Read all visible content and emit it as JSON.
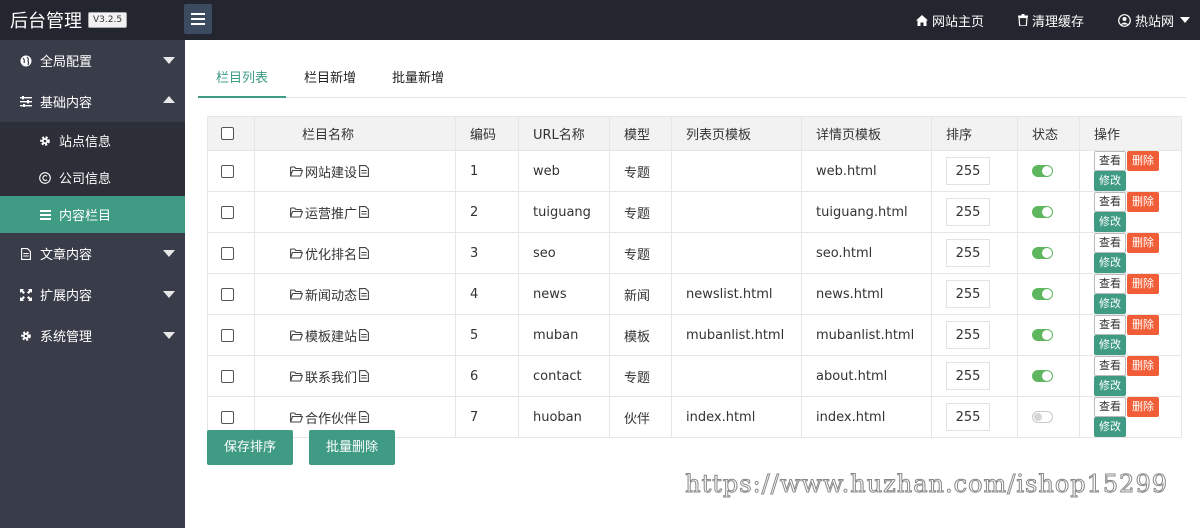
{
  "header": {
    "logo": "后台管理",
    "version": "V3.2.5",
    "links": [
      {
        "label": "网站主页",
        "icon": "home-icon"
      },
      {
        "label": "清理缓存",
        "icon": "trash-icon"
      },
      {
        "label": "热站网",
        "icon": "user-icon"
      }
    ]
  },
  "sidebar": {
    "items": [
      {
        "label": "全局配置",
        "icon": "globe-icon"
      },
      {
        "label": "基础内容",
        "icon": "sliders-icon"
      },
      {
        "label": "文章内容",
        "icon": "file-icon"
      },
      {
        "label": "扩展内容",
        "icon": "expand-icon"
      },
      {
        "label": "系统管理",
        "icon": "gear-icon"
      }
    ],
    "sub": [
      {
        "label": "站点信息",
        "icon": "gear-icon"
      },
      {
        "label": "公司信息",
        "icon": "copyright-icon"
      },
      {
        "label": "内容栏目",
        "icon": "list-icon"
      }
    ]
  },
  "tabs": [
    "栏目列表",
    "栏目新增",
    "批量新增"
  ],
  "table": {
    "headers": [
      "栏目名称",
      "编码",
      "URL名称",
      "模型",
      "列表页模板",
      "详情页模板",
      "排序",
      "状态",
      "操作"
    ],
    "rows": [
      {
        "name": "网站建设",
        "code": "1",
        "url": "web",
        "model": "专题",
        "list_tpl": "",
        "detail_tpl": "web.html",
        "sort": "255",
        "status": true
      },
      {
        "name": "运营推广",
        "code": "2",
        "url": "tuiguang",
        "model": "专题",
        "list_tpl": "",
        "detail_tpl": "tuiguang.html",
        "sort": "255",
        "status": true
      },
      {
        "name": "优化排名",
        "code": "3",
        "url": "seo",
        "model": "专题",
        "list_tpl": "",
        "detail_tpl": "seo.html",
        "sort": "255",
        "status": true
      },
      {
        "name": "新闻动态",
        "code": "4",
        "url": "news",
        "model": "新闻",
        "list_tpl": "newslist.html",
        "detail_tpl": "news.html",
        "sort": "255",
        "status": true
      },
      {
        "name": "模板建站",
        "code": "5",
        "url": "muban",
        "model": "模板",
        "list_tpl": "mubanlist.html",
        "detail_tpl": "mubanlist.html",
        "sort": "255",
        "status": true
      },
      {
        "name": "联系我们",
        "code": "6",
        "url": "contact",
        "model": "专题",
        "list_tpl": "",
        "detail_tpl": "about.html",
        "sort": "255",
        "status": true
      },
      {
        "name": "合作伙伴",
        "code": "7",
        "url": "huoban",
        "model": "伙伴",
        "list_tpl": "index.html",
        "detail_tpl": "index.html",
        "sort": "255",
        "status": false
      }
    ],
    "row_actions": {
      "view": "查看",
      "delete": "删除",
      "edit": "修改"
    }
  },
  "buttons": {
    "save_sort": "保存排序",
    "batch_delete": "批量删除"
  },
  "watermark": "https://www.huzhan.com/ishop15299",
  "colors": {
    "accent": "#3f9b84",
    "danger": "#f05d36",
    "sidebar": "#393d49",
    "topbar": "#23262e"
  }
}
